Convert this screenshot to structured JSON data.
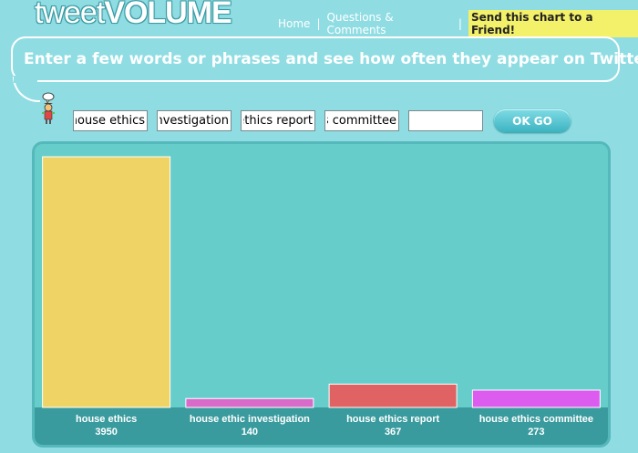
{
  "app": {
    "logo_small": "tweet",
    "logo_big": "VOLUME"
  },
  "nav": {
    "home": "Home",
    "sep1": "|",
    "questions": "Questions & Comments",
    "sep2": "|",
    "send": "Send this chart to a Friend!"
  },
  "tagline": "Enter a few words or phrases and see how often they appear on Twitter.",
  "search": {
    "fields": [
      {
        "value": "house ethics"
      },
      {
        "value": "house ethic investigation"
      },
      {
        "value": "house ethics report"
      },
      {
        "value": "house ethics committee"
      },
      {
        "value": ""
      }
    ],
    "ok_label": "OK GO"
  },
  "colors": {
    "background": "#8fdde3",
    "chart_bg": "#67cdcb",
    "label_band": "#3a9b9e",
    "bars": [
      "#efd364",
      "#d86ac9",
      "#e06262",
      "#dd5cf0"
    ]
  },
  "chart_data": {
    "type": "bar",
    "categories": [
      "house ethics",
      "house ethic investigation",
      "house ethics report",
      "house ethics committee"
    ],
    "values": [
      3950,
      140,
      367,
      273
    ],
    "ylim": [
      0,
      3950
    ],
    "grid": false
  }
}
